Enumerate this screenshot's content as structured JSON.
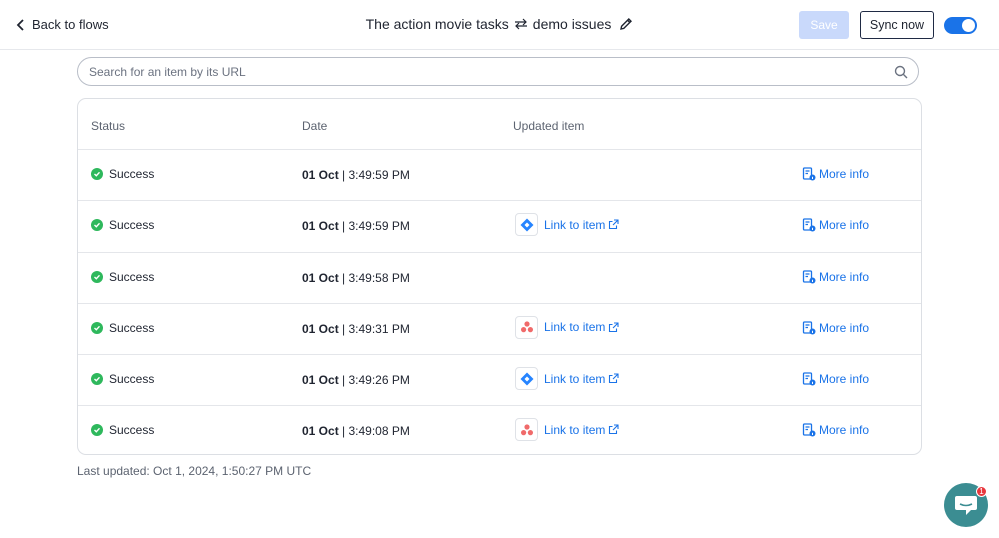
{
  "header": {
    "back_label": "Back to flows",
    "flow_left": "The action movie tasks",
    "flow_right": "demo issues",
    "save_label": "Save",
    "sync_label": "Sync now",
    "toggle_on": true
  },
  "search": {
    "placeholder": "Search for an item by its URL",
    "value": ""
  },
  "table": {
    "columns": [
      "Status",
      "Date",
      "Updated item"
    ],
    "rows": [
      {
        "status": "Success",
        "date_day": "01 Oct",
        "date_time": " | 3:49:59 PM",
        "app_icon": "",
        "link_label": "",
        "more_label": "More info"
      },
      {
        "status": "Success",
        "date_day": "01 Oct",
        "date_time": " | 3:49:59 PM",
        "app_icon": "jira-icon",
        "link_label": "Link to item",
        "more_label": "More info"
      },
      {
        "status": "Success",
        "date_day": "01 Oct",
        "date_time": " | 3:49:58 PM",
        "app_icon": "",
        "link_label": "",
        "more_label": "More info"
      },
      {
        "status": "Success",
        "date_day": "01 Oct",
        "date_time": " | 3:49:31 PM",
        "app_icon": "asana-icon",
        "link_label": "Link to item",
        "more_label": "More info"
      },
      {
        "status": "Success",
        "date_day": "01 Oct",
        "date_time": " | 3:49:26 PM",
        "app_icon": "jira-icon",
        "link_label": "Link to item",
        "more_label": "More info"
      },
      {
        "status": "Success",
        "date_day": "01 Oct",
        "date_time": " | 3:49:08 PM",
        "app_icon": "asana-icon",
        "link_label": "Link to item",
        "more_label": "More info"
      }
    ]
  },
  "footer": {
    "last_updated": "Last updated: Oct 1, 2024, 1:50:27 PM UTC"
  },
  "chat": {
    "unread_count": "1"
  },
  "colors": {
    "accent": "#1a73e8",
    "success": "#2eb85c",
    "save_disabled": "#c9d9fb",
    "chat": "#3b8d92",
    "badge": "#e8373d"
  }
}
